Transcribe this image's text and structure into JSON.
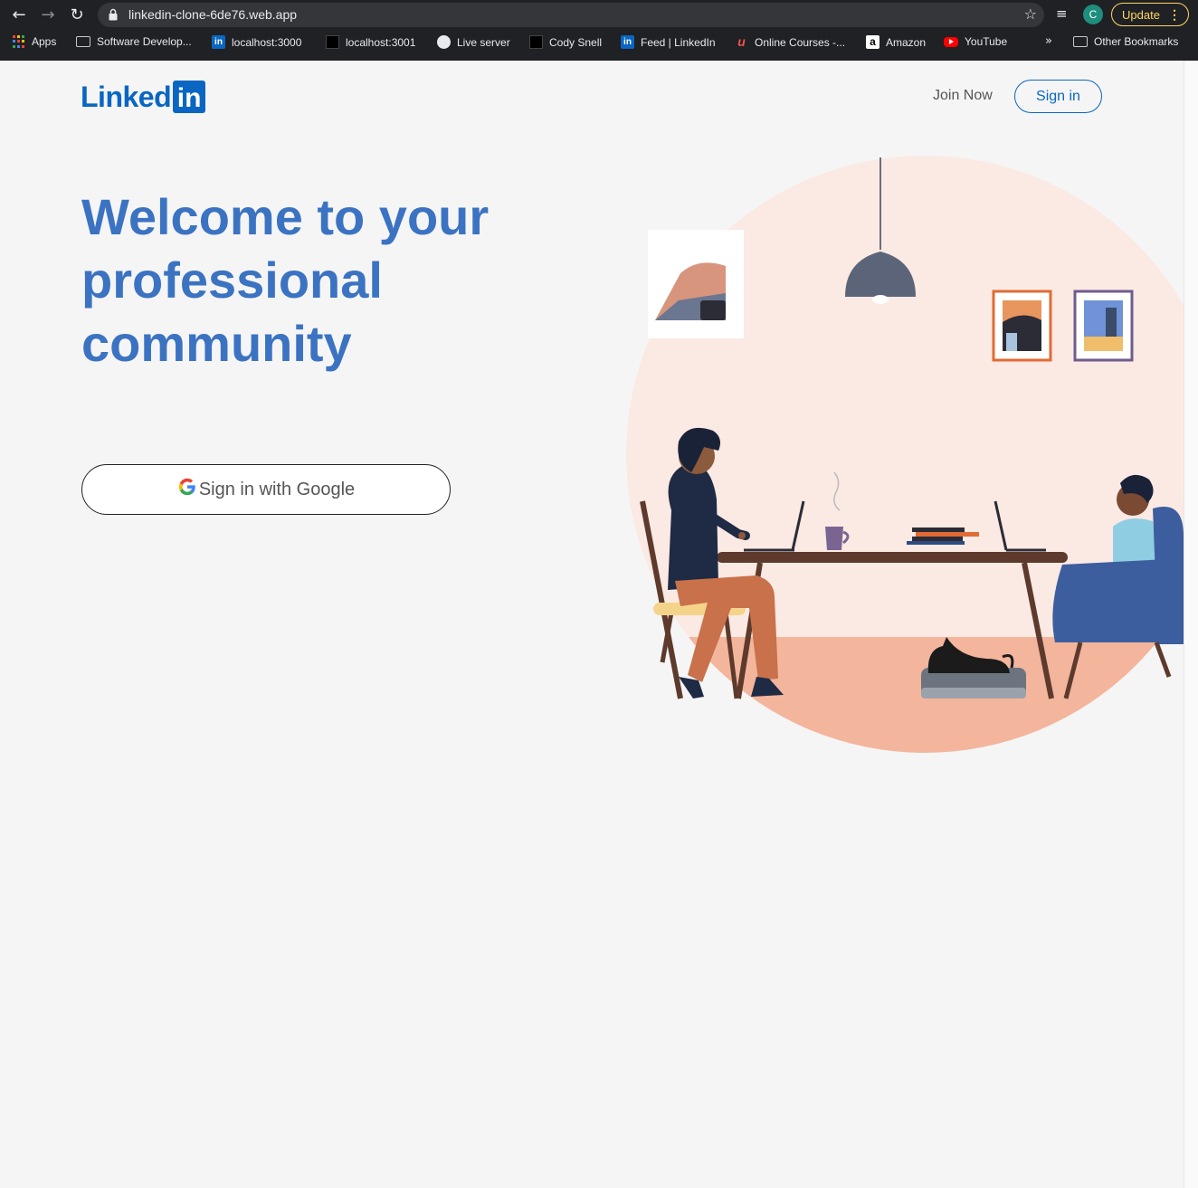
{
  "browser": {
    "url": "linkedin-clone-6de76.web.app",
    "profile_initial": "C",
    "update_label": "Update",
    "bookmarks": [
      {
        "label": "Apps",
        "icon": "apps-grid-icon"
      },
      {
        "label": "Software Develop...",
        "icon": "folder-icon"
      },
      {
        "label": "localhost:3000",
        "icon": "linkedin-icon"
      },
      {
        "label": "localhost:3001",
        "icon": "dark-site-icon"
      },
      {
        "label": "Live server",
        "icon": "globe-icon"
      },
      {
        "label": "Cody Snell",
        "icon": "dark-site-icon"
      },
      {
        "label": "Feed | LinkedIn",
        "icon": "linkedin-icon"
      },
      {
        "label": "Online Courses -...",
        "icon": "udemy-icon"
      },
      {
        "label": "Amazon",
        "icon": "amazon-icon"
      },
      {
        "label": "YouTube",
        "icon": "youtube-icon"
      }
    ],
    "more_bookmarks": "»",
    "other_bookmarks": "Other Bookmarks"
  },
  "header": {
    "logo_text": "Linked",
    "logo_box": "in",
    "join_label": "Join Now",
    "signin_label": "Sign in"
  },
  "hero": {
    "headline": "Welcome to your professional community",
    "google_button_label": "Sign in with Google",
    "google_glyph": "G"
  },
  "colors": {
    "brand": "#0a66c2",
    "headline": "#3b73c2",
    "update_accent": "#fdd663"
  }
}
